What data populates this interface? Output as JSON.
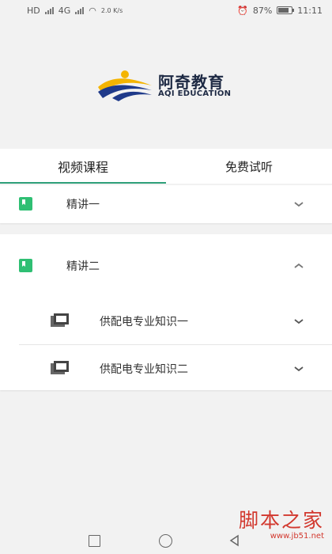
{
  "status_bar": {
    "carrier_left": "HD",
    "network": "4G",
    "speed": "2.0 K/s",
    "battery": "87%",
    "time": "11:11"
  },
  "logo": {
    "name_cn": "阿奇教育",
    "name_en": "AQI EDUCATION",
    "colors": {
      "blue": "#1f3a8a",
      "yellow": "#f4b400",
      "text": "#1e2a44"
    }
  },
  "tabs": [
    {
      "label": "视频课程",
      "active": true
    },
    {
      "label": "免费试听",
      "active": false
    }
  ],
  "sections": [
    {
      "title": "精讲一",
      "expanded": false,
      "children": []
    },
    {
      "title": "精讲二",
      "expanded": true,
      "children": [
        {
          "title": "供配电专业知识一"
        },
        {
          "title": "供配电专业知识二"
        }
      ]
    }
  ],
  "watermark": {
    "cn": "脚本之家",
    "url": "www.jb51.net"
  },
  "accent_color": "#2fbf73"
}
